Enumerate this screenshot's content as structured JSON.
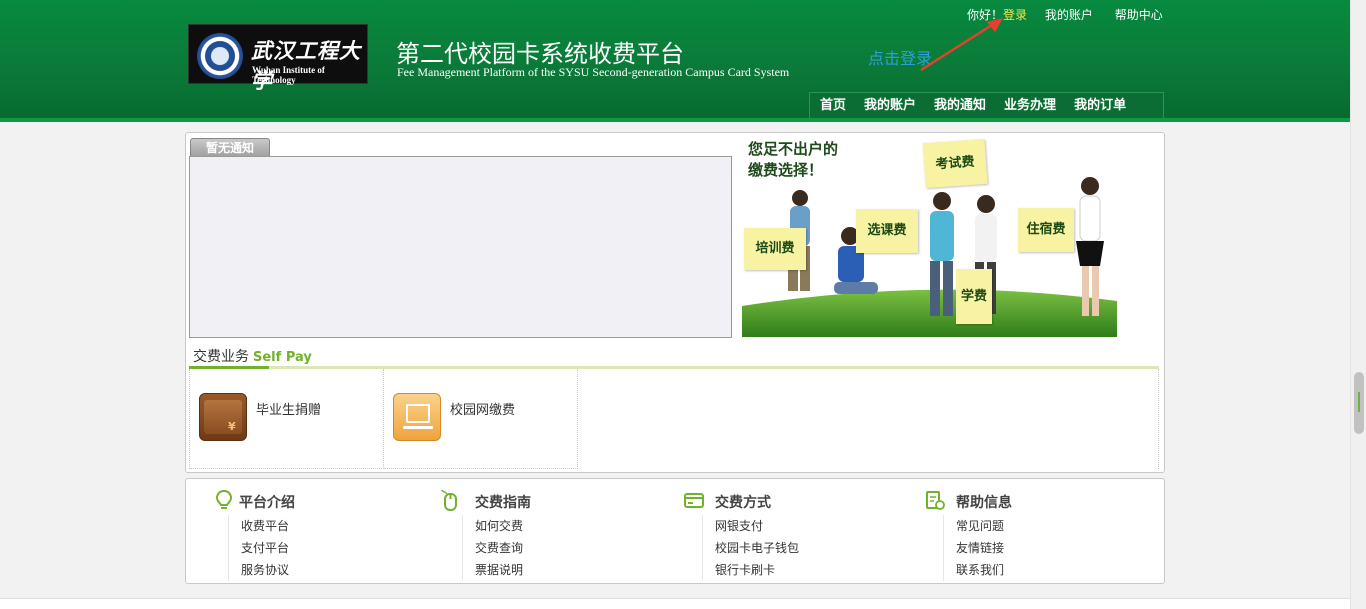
{
  "header": {
    "logo_cn": "武汉工程大学",
    "logo_en": "Wuhan Institute of Technology",
    "title": "第二代校园卡系统收费平台",
    "subtitle": "Fee Management Platform of the SYSU Second-generation Campus Card System",
    "greeting": "你好！",
    "login_label": "登录",
    "my_account_label": "我的账户",
    "help_center_label": "帮助中心",
    "annotation_text": "点击登录"
  },
  "nav": {
    "items": [
      "首页",
      "我的账户",
      "我的通知",
      "业务办理",
      "我的订单"
    ]
  },
  "notice": {
    "tab_label": "暂无通知"
  },
  "banner": {
    "slogan_line1": "您足不出户的",
    "slogan_line2": "缴费选择！",
    "notes": [
      "考试费",
      "选课费",
      "住宿费",
      "培训费",
      "学费"
    ]
  },
  "selfpay": {
    "title": "交费业务",
    "title_en": "Self Pay",
    "services": [
      {
        "label": "毕业生捐赠",
        "icon": "wallet-icon"
      },
      {
        "label": "校园网缴费",
        "icon": "campus-network-icon"
      }
    ]
  },
  "footer": {
    "columns": [
      {
        "title": "平台介绍",
        "icon": "lightbulb-icon",
        "links": [
          "收费平台",
          "支付平台",
          "服务协议"
        ]
      },
      {
        "title": "交费指南",
        "icon": "mouse-icon",
        "links": [
          "如何交费",
          "交费查询",
          "票据说明"
        ]
      },
      {
        "title": "交费方式",
        "icon": "card-icon",
        "links": [
          "网银支付",
          "校园卡电子钱包",
          "银行卡刷卡"
        ]
      },
      {
        "title": "帮助信息",
        "icon": "help-doc-icon",
        "links": [
          "常见问题",
          "友情链接",
          "联系我们"
        ]
      }
    ]
  },
  "colors": {
    "header_green": "#078a3f",
    "accent_green": "#72b12b",
    "login_yellow": "#f5e94a",
    "annotation_blue": "#2d9fd8",
    "annotation_arrow": "#e8402c"
  }
}
